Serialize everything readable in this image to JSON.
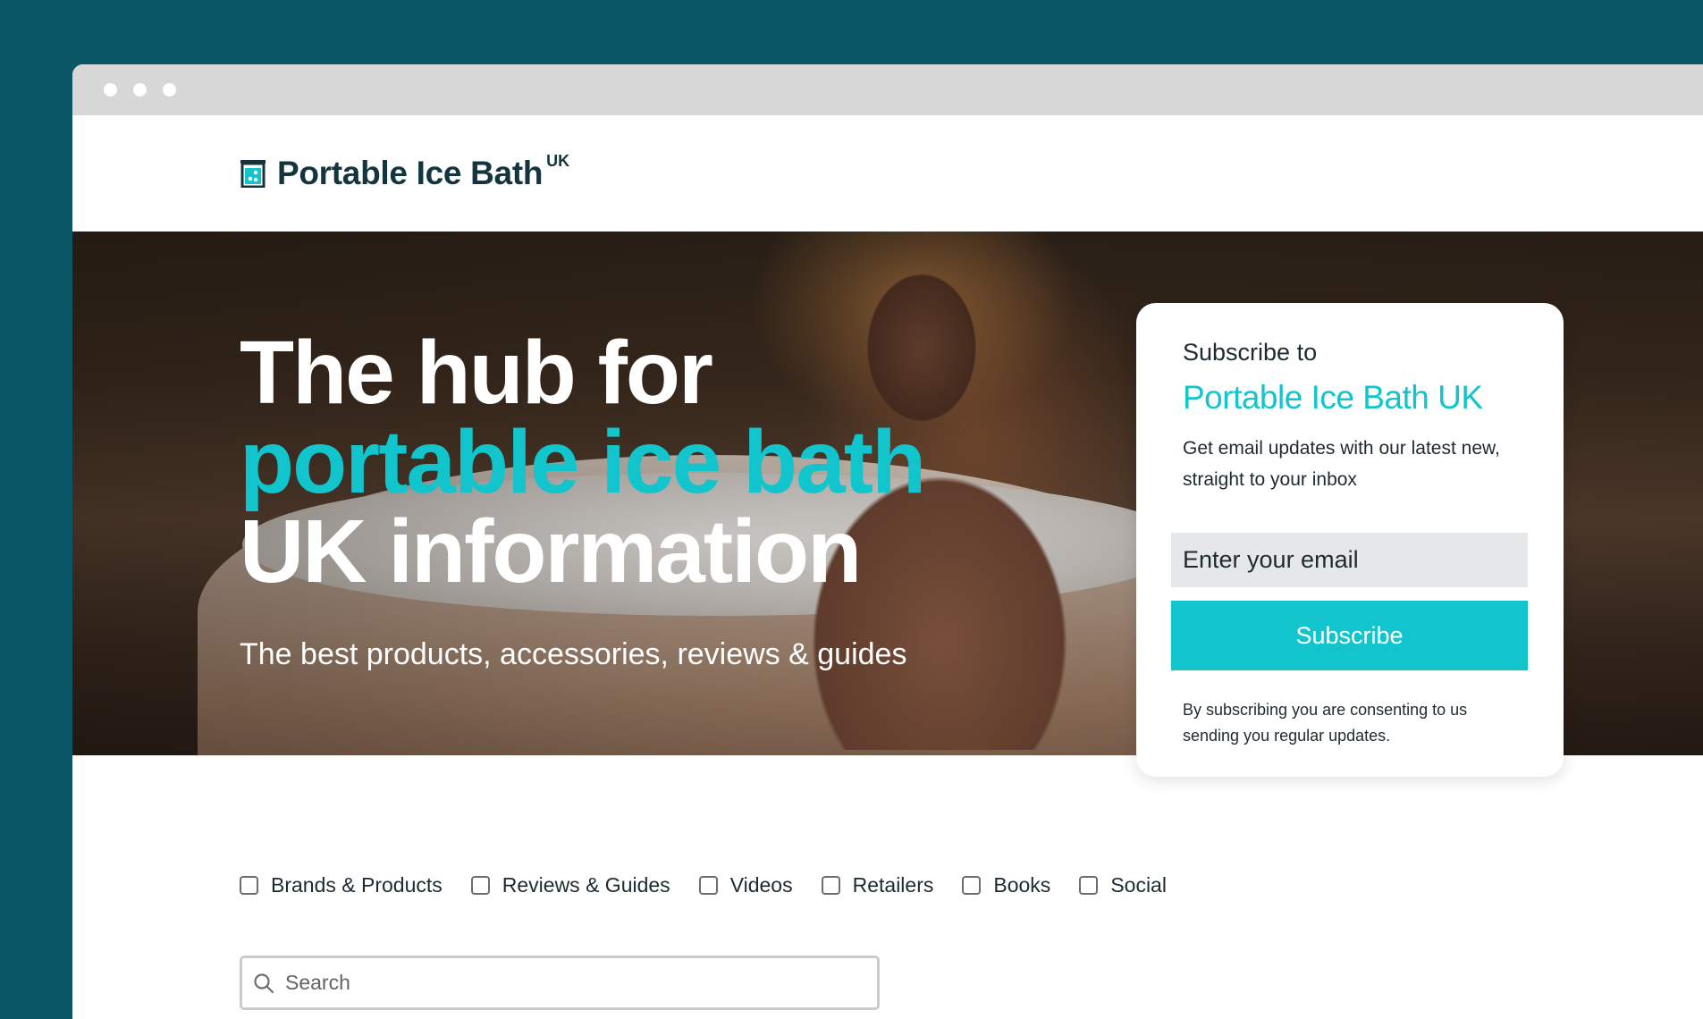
{
  "brand": {
    "name": "Portable Ice Bath",
    "suffix": "UK",
    "icon": "ice-bath-logo-icon"
  },
  "hero": {
    "line1": "The hub for",
    "line2": "portable ice bath",
    "line3": "UK information",
    "subtitle": "The best products, accessories, reviews & guides"
  },
  "subscribe": {
    "pre_title": "Subscribe to",
    "brand_title": "Portable Ice Bath UK",
    "description": "Get email updates with our latest new, straight to your inbox",
    "email_placeholder": "Enter your email",
    "button_label": "Subscribe",
    "consent_note": "By subscribing you are consenting to us sending you regular updates."
  },
  "filters": [
    {
      "label": "Brands & Products",
      "checked": false
    },
    {
      "label": "Reviews & Guides",
      "checked": false
    },
    {
      "label": "Videos",
      "checked": false
    },
    {
      "label": "Retailers",
      "checked": false
    },
    {
      "label": "Books",
      "checked": false
    },
    {
      "label": "Social",
      "checked": false
    }
  ],
  "search": {
    "placeholder": "Search",
    "icon": "search-icon"
  },
  "colors": {
    "background": "#0a5566",
    "accent": "#12c4cc",
    "brand_text": "#14353d"
  }
}
